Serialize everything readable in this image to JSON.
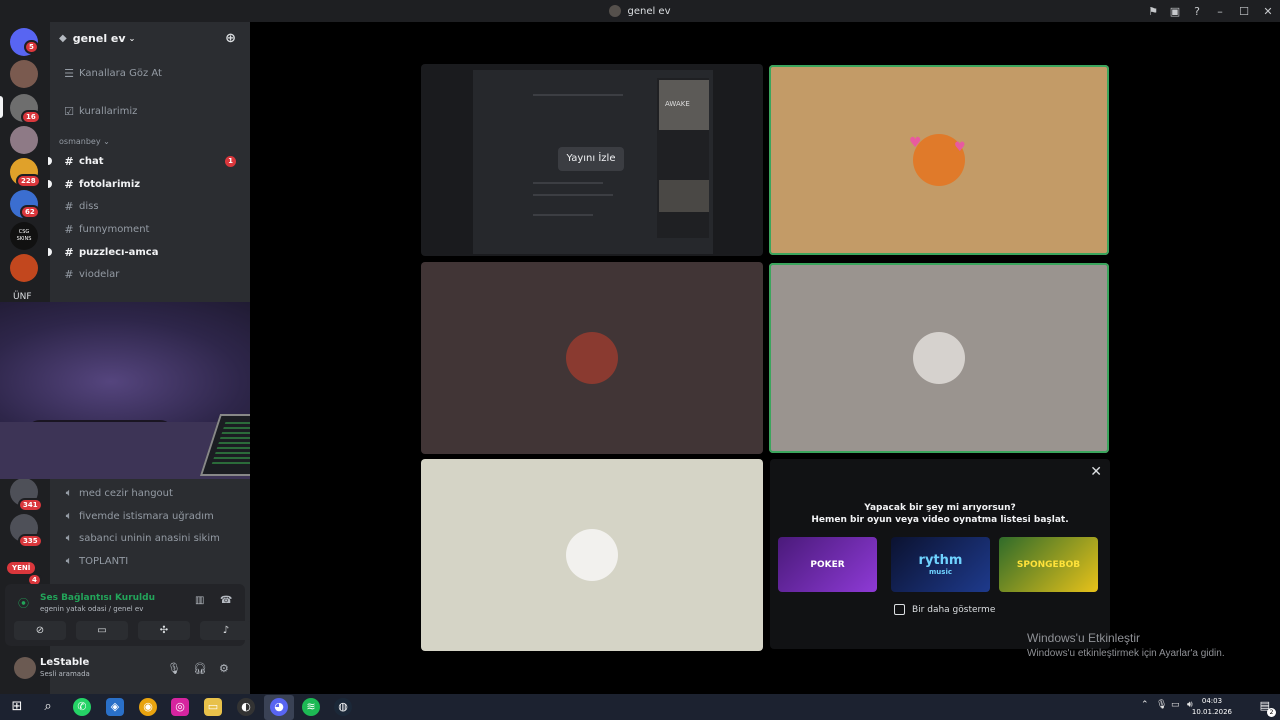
{
  "window": {
    "title": "genel ev"
  },
  "guilds": {
    "badges": [
      "5",
      "16",
      "228",
      "62",
      "341",
      "335",
      "4"
    ],
    "csgo_label": "CSG\nSKINS",
    "new_label": "YENİ",
    "partial_label": "ÜNF"
  },
  "server": {
    "name": "genel ev"
  },
  "channels": {
    "browse": "Kanallara Göz At",
    "rules": "kurallarimiz",
    "category": "osmanbey",
    "text": [
      {
        "name": "chat",
        "bold": true,
        "unread": "1"
      },
      {
        "name": "fotolarimiz",
        "bold": true
      },
      {
        "name": "diss",
        "bold": false
      },
      {
        "name": "funnymoment",
        "bold": false
      },
      {
        "name": "puzzlecı-amca",
        "bold": true
      },
      {
        "name": "viodelar",
        "bold": false
      }
    ],
    "voice": [
      "med cezir hangout",
      "fivemde istismara uğradım",
      "sabanci uninin anasini sikim",
      "TOPLANTI"
    ]
  },
  "voice_panel": {
    "status": "Ses Bağlantısı Kuruldu",
    "location": "egenin yatak odasi / genel ev"
  },
  "user": {
    "name": "LeStable",
    "status": "Sesli aramada"
  },
  "stream": {
    "watch_label": "Yayını İzle",
    "art_text": "AWAKE"
  },
  "activity": {
    "title": "Yapacak bir şey mi arıyorsun?",
    "subtitle": "Hemen bir oyun veya video oynatma listesi başlat.",
    "games": [
      {
        "name": "POKER",
        "color": "#6b2bb3"
      },
      {
        "name": "rythm",
        "sub": "music",
        "color": "#1a2b6b"
      },
      {
        "name": "SPONGEBOB",
        "color": "#3d7a2a"
      }
    ],
    "checkbox_label": "Bir daha gösterme"
  },
  "windows_activation": {
    "title": "Windows'u Etkinleştir",
    "subtitle": "Windows'u etkinleştirmek için Ayarlar'a gidin."
  },
  "taskbar": {
    "time": "04:03",
    "date": "10.01.2026",
    "notification_count": "2"
  },
  "colors": {
    "speaking": "#3ba55d",
    "tile_orange": "#c39b67",
    "tile_dark": "#413536",
    "tile_gray": "#9a948f",
    "tile_light": "#d5d4c6",
    "accent": "#5865f2"
  }
}
